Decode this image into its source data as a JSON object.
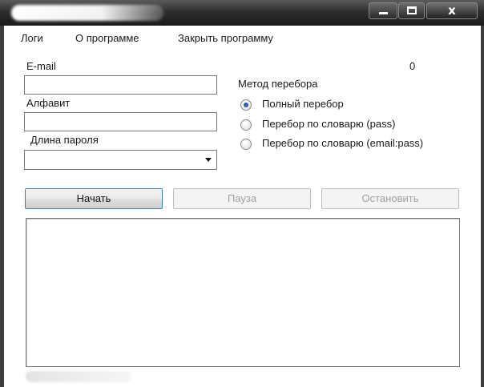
{
  "window": {
    "title": "",
    "controls": {
      "minimize": "",
      "maximize": "",
      "close": "x"
    }
  },
  "menu": {
    "items": [
      "Логи",
      "О программе",
      "Закрыть программу"
    ]
  },
  "form": {
    "email_label": "E-mail",
    "email_value": "",
    "counter": "0",
    "alphabet_label": "Алфавит",
    "alphabet_value": "",
    "length_label": "Длина пароля",
    "length_value": ""
  },
  "method": {
    "label": "Метод перебора",
    "options": [
      {
        "label": "Полный перебор",
        "checked": true
      },
      {
        "label": "Перебор по словарю (pass)",
        "checked": false
      },
      {
        "label": "Перебор по словарю (email:pass)",
        "checked": false
      }
    ]
  },
  "actions": {
    "start": "Начать",
    "pause": "Пауза",
    "stop": "Остановить"
  },
  "log": {
    "content": ""
  },
  "colors": {
    "titlebar": "#2e2e2e",
    "radio_selected": "#2b5fb0",
    "default_button_border": "#3c7fb1",
    "disabled_text": "#a0a0a0"
  }
}
